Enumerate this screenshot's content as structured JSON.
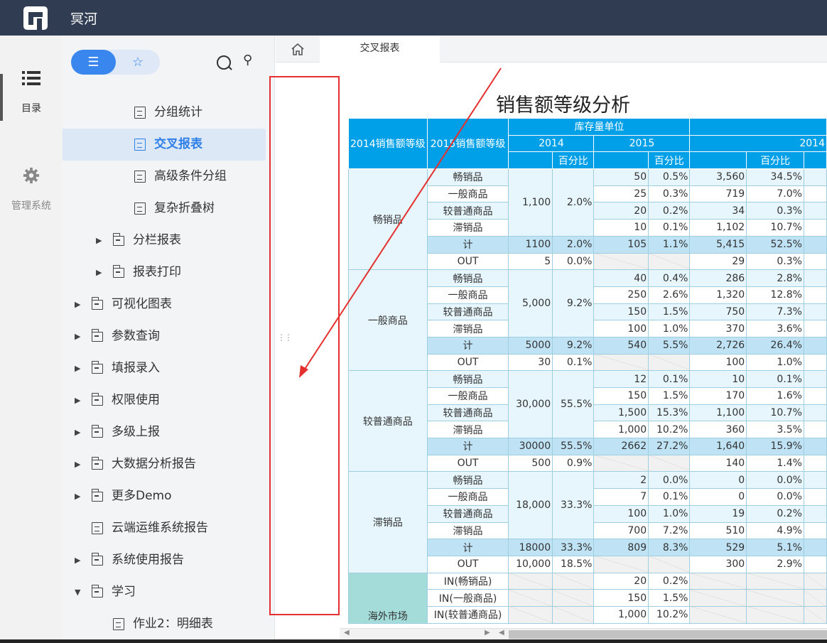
{
  "app": {
    "title": "冥河"
  },
  "rail": {
    "catalog_label": "目录",
    "manage_label": "管理系统"
  },
  "tree": {
    "items": [
      {
        "label": "分组统计",
        "type": "doc",
        "indent": 3,
        "selected": false
      },
      {
        "label": "交叉报表",
        "type": "doc",
        "indent": 3,
        "selected": true
      },
      {
        "label": "高级条件分组",
        "type": "doc",
        "indent": 3,
        "selected": false
      },
      {
        "label": "复杂折叠树",
        "type": "doc",
        "indent": 3,
        "selected": false
      },
      {
        "label": "分栏报表",
        "type": "folder",
        "indent": 2,
        "expanded": false
      },
      {
        "label": "报表打印",
        "type": "folder",
        "indent": 2,
        "expanded": false
      },
      {
        "label": "可视化图表",
        "type": "folder",
        "indent": 1,
        "expanded": false
      },
      {
        "label": "参数查询",
        "type": "folder",
        "indent": 1,
        "expanded": false
      },
      {
        "label": "填报录入",
        "type": "folder",
        "indent": 1,
        "expanded": false
      },
      {
        "label": "权限使用",
        "type": "folder",
        "indent": 1,
        "expanded": false
      },
      {
        "label": "多级上报",
        "type": "folder",
        "indent": 1,
        "expanded": false
      },
      {
        "label": "大数据分析报告",
        "type": "folder",
        "indent": 1,
        "expanded": false
      },
      {
        "label": "更多Demo",
        "type": "folder",
        "indent": 1,
        "expanded": false
      },
      {
        "label": "云端运维系统报告",
        "type": "doc",
        "indent": 1,
        "selected": false
      },
      {
        "label": "系统使用报告",
        "type": "folder",
        "indent": 1,
        "expanded": false
      },
      {
        "label": "学习",
        "type": "folder",
        "indent": 1,
        "expanded": true
      },
      {
        "label": "作业2：明细表",
        "type": "doc",
        "indent": 2,
        "selected": false
      }
    ]
  },
  "tabs": {
    "report_tab": "交叉报表"
  },
  "report": {
    "title": "销售额等级分析",
    "headers": {
      "level2014": "2014销售额等级",
      "level2015": "2015销售额等级",
      "inventory": "库存量单位",
      "y2014": "2014",
      "y2015": "2015",
      "y2014b": "2014",
      "pct": "百分比"
    },
    "groups": [
      {
        "name": "畅销品",
        "base": "1,100",
        "base_pct": "2.0%",
        "rows": [
          {
            "sub": "畅销品",
            "v1": "50",
            "p1": "0.5%",
            "v2": "3,560",
            "p2": "34.5%"
          },
          {
            "sub": "一般商品",
            "v1": "25",
            "p1": "0.3%",
            "v2": "719",
            "p2": "7.0%"
          },
          {
            "sub": "较普通商品",
            "v1": "20",
            "p1": "0.2%",
            "v2": "34",
            "p2": "0.3%"
          },
          {
            "sub": "滞销品",
            "v1": "10",
            "p1": "0.1%",
            "v2": "1,102",
            "p2": "10.7%"
          }
        ],
        "total": {
          "label": "计",
          "a": "1100",
          "ap": "2.0%",
          "v1": "105",
          "p1": "1.1%",
          "v2": "5,415",
          "p2": "52.5%"
        },
        "out": {
          "label": "OUT",
          "a": "5",
          "ap": "0.0%",
          "v2": "29",
          "p2": "0.3%"
        }
      },
      {
        "name": "一般商品",
        "base": "5,000",
        "base_pct": "9.2%",
        "rows": [
          {
            "sub": "畅销品",
            "v1": "40",
            "p1": "0.4%",
            "v2": "286",
            "p2": "2.8%"
          },
          {
            "sub": "一般商品",
            "v1": "250",
            "p1": "2.6%",
            "v2": "1,320",
            "p2": "12.8%"
          },
          {
            "sub": "较普通商品",
            "v1": "150",
            "p1": "1.5%",
            "v2": "750",
            "p2": "7.3%"
          },
          {
            "sub": "滞销品",
            "v1": "100",
            "p1": "1.0%",
            "v2": "370",
            "p2": "3.6%"
          }
        ],
        "total": {
          "label": "计",
          "a": "5000",
          "ap": "9.2%",
          "v1": "540",
          "p1": "5.5%",
          "v2": "2,726",
          "p2": "26.4%"
        },
        "out": {
          "label": "OUT",
          "a": "30",
          "ap": "0.1%",
          "v2": "100",
          "p2": "1.0%"
        }
      },
      {
        "name": "较普通商品",
        "base": "30,000",
        "base_pct": "55.5%",
        "rows": [
          {
            "sub": "畅销品",
            "v1": "12",
            "p1": "0.1%",
            "v2": "10",
            "p2": "0.1%"
          },
          {
            "sub": "一般商品",
            "v1": "150",
            "p1": "1.5%",
            "v2": "170",
            "p2": "1.6%"
          },
          {
            "sub": "较普通商品",
            "v1": "1,500",
            "p1": "15.3%",
            "v2": "1,100",
            "p2": "10.7%"
          },
          {
            "sub": "滞销品",
            "v1": "1,000",
            "p1": "10.2%",
            "v2": "360",
            "p2": "3.5%"
          }
        ],
        "total": {
          "label": "计",
          "a": "30000",
          "ap": "55.5%",
          "v1": "2662",
          "p1": "27.2%",
          "v2": "1,640",
          "p2": "15.9%"
        },
        "out": {
          "label": "OUT",
          "a": "500",
          "ap": "0.9%",
          "v2": "140",
          "p2": "1.4%"
        }
      },
      {
        "name": "滞销品",
        "base": "18,000",
        "base_pct": "33.3%",
        "rows": [
          {
            "sub": "畅销品",
            "v1": "2",
            "p1": "0.0%",
            "v2": "0",
            "p2": "0.0%"
          },
          {
            "sub": "一般商品",
            "v1": "7",
            "p1": "0.1%",
            "v2": "0",
            "p2": "0.0%"
          },
          {
            "sub": "较普通商品",
            "v1": "100",
            "p1": "1.0%",
            "v2": "19",
            "p2": "0.2%"
          },
          {
            "sub": "滞销品",
            "v1": "700",
            "p1": "7.2%",
            "v2": "510",
            "p2": "4.9%"
          }
        ],
        "total": {
          "label": "计",
          "a": "18000",
          "ap": "33.3%",
          "v1": "809",
          "p1": "8.3%",
          "v2": "529",
          "p2": "5.1%"
        },
        "out": {
          "label": "OUT",
          "a": "10,000",
          "ap": "18.5%",
          "v2": "300",
          "p2": "2.9%"
        }
      }
    ],
    "oversea": {
      "name": "海外市场",
      "rows": [
        {
          "sub": "IN(畅销品)",
          "v1": "20",
          "p1": "0.2%"
        },
        {
          "sub": "IN(一般商品)",
          "v1": "150",
          "p1": "1.5%"
        },
        {
          "sub": "IN(较普通商品)",
          "v1": "1,000",
          "p1": "10.2%"
        }
      ]
    }
  },
  "colors": {
    "topbar": "#2f3c52",
    "accent": "#3a86ef",
    "header": "#00a0e9",
    "annotation": "#e53030"
  }
}
